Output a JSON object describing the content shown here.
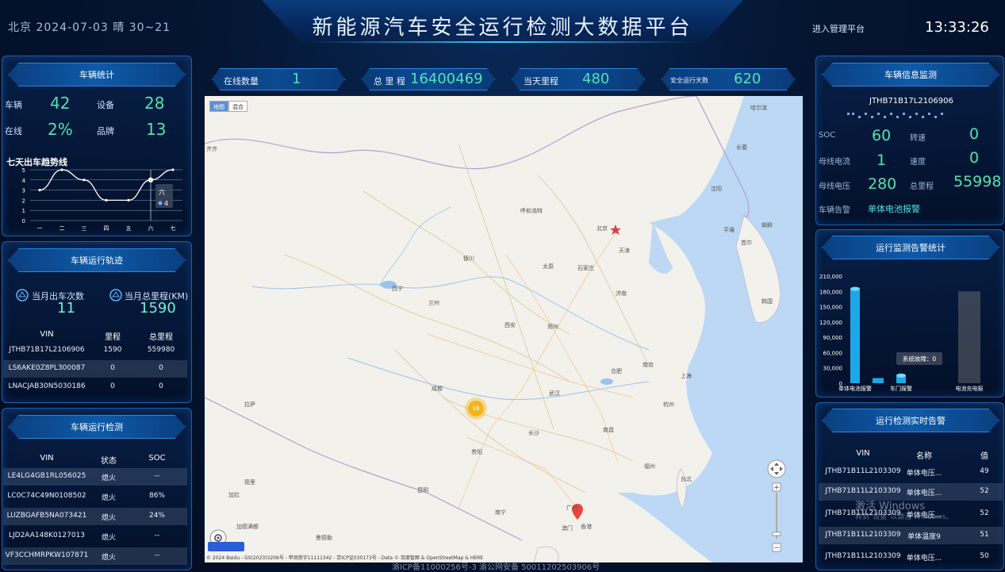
{
  "header": {
    "location_weather": "北京 2024-07-03 晴 30~21",
    "title": "新能源汽车安全运行检测大数据平台",
    "admin_link": "进入管理平台",
    "clock": "13:33:26"
  },
  "vehicle_stats": {
    "title": "车辆统计",
    "items": [
      {
        "label": "车辆",
        "value": "42"
      },
      {
        "label": "设备",
        "value": "28"
      },
      {
        "label": "在线",
        "value": "2%"
      },
      {
        "label": "品牌",
        "value": "13"
      }
    ],
    "trend_title": "七天出车趋势线",
    "tooltip_day": "六",
    "tooltip_value": "4"
  },
  "chart_data": [
    {
      "type": "line",
      "title": "七天出车趋势线",
      "categories": [
        "一",
        "二",
        "三",
        "四",
        "五",
        "六",
        "七"
      ],
      "values": [
        3,
        5,
        4,
        2,
        2,
        4,
        5
      ],
      "ylim": [
        0,
        5
      ],
      "yticks": [
        "0",
        "1",
        "2",
        "3",
        "4",
        "5"
      ],
      "grid": true
    },
    {
      "type": "bar",
      "categories": [
        "单体电池报警",
        "车门报警",
        "电池充电报"
      ],
      "values": [
        185000,
        15000,
        180000
      ],
      "yticks": [
        "0",
        "30,000",
        "60,000",
        "90,000",
        "120,000",
        "150,000",
        "180,000",
        "210,000"
      ],
      "ylim": [
        0,
        210000
      ],
      "tooltip": "系统故障：0"
    }
  ],
  "trajectory": {
    "title": "车辆运行轨迹",
    "month_trips_label": "当月出车次数",
    "month_trips_value": "11",
    "month_km_label": "当月总里程(KM)",
    "month_km_value": "1590",
    "columns": [
      "VIN",
      "里程",
      "总里程"
    ],
    "rows": [
      [
        "JTHB71B17L2106906",
        "1590",
        "559980"
      ],
      [
        "LS6AKE0Z8PL300087",
        "0",
        "0"
      ],
      [
        "LNACJAB30N5030186",
        "0",
        "0"
      ]
    ]
  },
  "detection": {
    "title": "车辆运行检测",
    "columns": [
      "VIN",
      "状态",
      "SOC"
    ],
    "rows": [
      [
        "LE4LG4GB1RL056025",
        "熄火",
        "--"
      ],
      [
        "LC0C74C49N0108502",
        "熄火",
        "86%"
      ],
      [
        "LUZBGAFB5NA073421",
        "熄火",
        "24%"
      ],
      [
        "LJD2AA148K0127013",
        "熄火",
        "--"
      ],
      [
        "VF3CCHMRPKW107871",
        "熄火",
        "--"
      ]
    ]
  },
  "top_stats": [
    {
      "label": "在线数量",
      "value": "1"
    },
    {
      "label": "总 里 程",
      "value": "16400469"
    },
    {
      "label": "当天里程",
      "value": "480"
    },
    {
      "label": "安全运行天数",
      "value": "620"
    }
  ],
  "map": {
    "tabs": [
      "地图",
      "混合"
    ],
    "cluster_count": "16",
    "copyright": "© 2024 Baidu - GS(2023)3206号 - 甲测资字11111342 - 京ICP证030173号 - Data © 百度智图 & OpenStreetMap & HERE",
    "cities": [
      {
        "name": "哈尔滨"
      },
      {
        "name": "长春"
      },
      {
        "name": "沈阳"
      },
      {
        "name": "呼和浩特"
      },
      {
        "name": "北京"
      },
      {
        "name": "天津"
      },
      {
        "name": "太原"
      },
      {
        "name": "石家庄"
      },
      {
        "name": "银川"
      },
      {
        "name": "西宁"
      },
      {
        "name": "兰州"
      },
      {
        "name": "济南"
      },
      {
        "name": "西安"
      },
      {
        "name": "郑州"
      },
      {
        "name": "合肥"
      },
      {
        "name": "南京"
      },
      {
        "name": "上海"
      },
      {
        "name": "成都"
      },
      {
        "name": "武汉"
      },
      {
        "name": "杭州"
      },
      {
        "name": "长沙"
      },
      {
        "name": "南昌"
      },
      {
        "name": "贵阳"
      },
      {
        "name": "福州"
      },
      {
        "name": "台北"
      },
      {
        "name": "昆明"
      },
      {
        "name": "南宁"
      },
      {
        "name": "广州"
      },
      {
        "name": "香港"
      },
      {
        "name": "澳门"
      },
      {
        "name": "拉萨"
      },
      {
        "name": "加拉"
      },
      {
        "name": "首尔"
      },
      {
        "name": "朝鲜"
      },
      {
        "name": "韩国"
      },
      {
        "name": "平壤"
      },
      {
        "name": "齐齐"
      },
      {
        "name": "德里"
      },
      {
        "name": "加德满都"
      },
      {
        "name": "曼德勒"
      }
    ]
  },
  "vehicle_monitor": {
    "title": "车辆信息监测",
    "vin": "JTHB71B17L2106906",
    "fields": [
      {
        "label": "SOC",
        "value": "60"
      },
      {
        "label": "转速",
        "value": "0"
      },
      {
        "label": "母线电流",
        "value": "1"
      },
      {
        "label": "速度",
        "value": "0"
      },
      {
        "label": "母线电压",
        "value": "280"
      },
      {
        "label": "总里程",
        "value": "55998"
      }
    ],
    "alarm_label": "车辆告警",
    "alarm_value": "单体电池报警"
  },
  "alarm_stats": {
    "title": "运行监测告警统计"
  },
  "realtime": {
    "title": "运行检测实时告警",
    "columns": [
      "VIN",
      "名称",
      "值"
    ],
    "rows": [
      [
        "JTHB71B11L2103309",
        "单体电压...",
        "49"
      ],
      [
        "JTHB71B11L2103309",
        "单体电压...",
        "52"
      ],
      [
        "JTHB71B11L2103309",
        "单体电压...",
        "52"
      ],
      [
        "JTHB71B11L2103309",
        "单体温度9",
        "51"
      ],
      [
        "JTHB71B11L2103309",
        "单体电压...",
        "50"
      ]
    ]
  },
  "watermark": {
    "line1": "激活 Windows",
    "line2": "转到\"设置\"以激活 Windows。"
  },
  "footer": "渝ICP备11000256号-3 渝公网安备 50011202503906号",
  "colors": {
    "accent": "#4fe3b4",
    "panel_border": "#1a5fae",
    "bar": "#1ea7e8"
  }
}
